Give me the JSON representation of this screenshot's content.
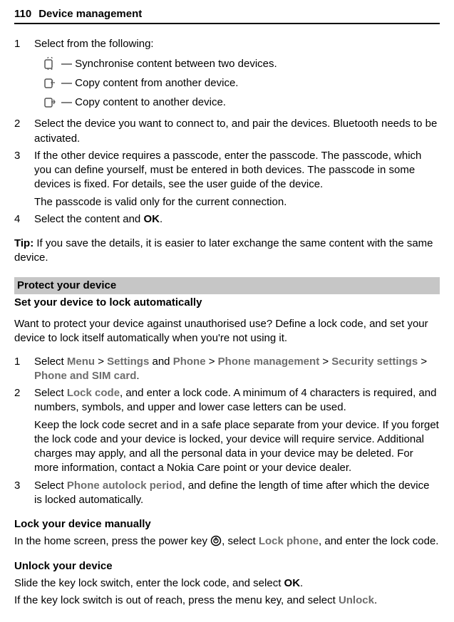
{
  "header": {
    "page_num": "110",
    "title": "Device management"
  },
  "sectionA": {
    "step1_lead": "Select from the following:",
    "opts": [
      " — Synchronise content between two devices.",
      " — Copy content from another device.",
      " — Copy content to another device."
    ],
    "step2": "Select the device you want to connect to, and pair the devices. Bluetooth needs to be activated.",
    "step3a": "If the other device requires a passcode, enter the passcode. The passcode, which you can define yourself, must be entered in both devices. The passcode in some devices is fixed. For details, see the user guide of the device.",
    "step3b": "The passcode is valid only for the current connection.",
    "step4_pre": "Select the content and ",
    "step4_ok": "OK",
    "step4_post": "."
  },
  "tip": {
    "label": "Tip:",
    "text": " If you save the details, it is easier to later exchange the same content with the same device."
  },
  "sectionB": {
    "bar": "Protect your device",
    "title": "Set your device to lock automatically",
    "intro": "Want to protect your device against unauthorised use? Define a lock code, and set your device to lock itself automatically when you're not using it.",
    "s1": {
      "pre": "Select ",
      "menu": "Menu",
      "gt1": " > ",
      "settings": "Settings",
      "and": " and ",
      "phone": "Phone",
      "gt2": " > ",
      "pm": "Phone management",
      "gt3": " > ",
      "sec": "Security settings",
      "gt4": " > ",
      "psim": "Phone and SIM card",
      "post": "."
    },
    "s2": {
      "pre": "Select ",
      "lock": "Lock code",
      "mid": ", and enter a lock code. A minimum of 4 characters is required, and numbers, symbols, and upper and lower case letters can be used."
    },
    "s2b": "Keep the lock code secret and in a safe place separate from your device. If you forget the lock code and your device is locked, your device will require service. Additional charges may apply, and all the personal data in your device may be deleted. For more information, contact a Nokia Care point or your device dealer.",
    "s3": {
      "pre": "Select ",
      "pap": "Phone autolock period",
      "post": ", and define the length of time after which the device is locked automatically."
    }
  },
  "lockManual": {
    "heading": "Lock your device manually",
    "pre": "In the home screen, press the power key ",
    "mid": ", select ",
    "lock": "Lock phone",
    "post": ", and enter the lock code."
  },
  "unlock": {
    "heading": "Unlock your device",
    "line1_pre": "Slide the key lock switch, enter the lock code, and select ",
    "ok": "OK",
    "line1_post": ".",
    "line2_pre": "If the key lock switch is out of reach, press the menu key, and select ",
    "un": "Unlock",
    "line2_post": "."
  }
}
